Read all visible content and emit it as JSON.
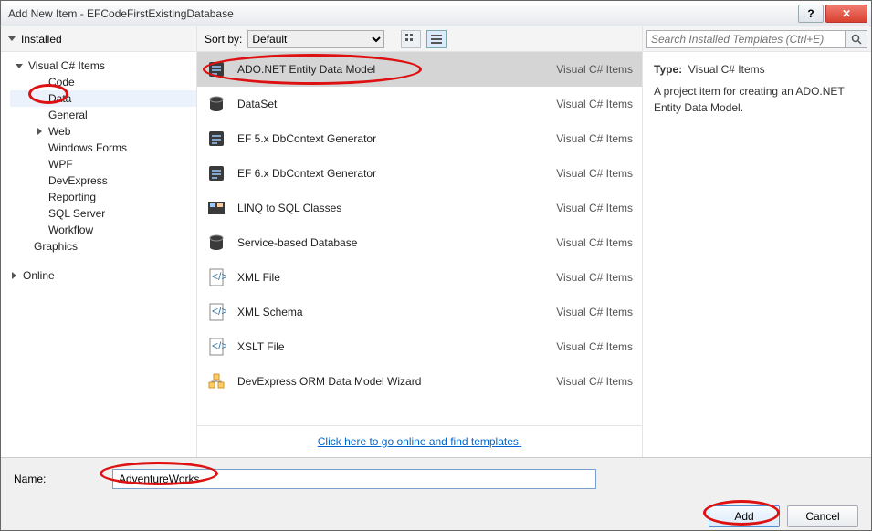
{
  "window": {
    "title": "Add New Item - EFCodeFirstExistingDatabase"
  },
  "left": {
    "header": "Installed",
    "tree": {
      "root": "Visual C# Items",
      "items": [
        "Code",
        "Data",
        "General",
        "Web",
        "Windows Forms",
        "WPF",
        "DevExpress",
        "Reporting",
        "SQL Server",
        "Workflow"
      ],
      "tail": "Graphics",
      "online": "Online"
    }
  },
  "mid": {
    "sortby_label": "Sort by:",
    "sortby_value": "Default",
    "items": [
      {
        "label": "ADO.NET Entity Data Model",
        "cat": "Visual C# Items",
        "selected": true,
        "icon": "entity"
      },
      {
        "label": "DataSet",
        "cat": "Visual C# Items",
        "icon": "db"
      },
      {
        "label": "EF 5.x DbContext Generator",
        "cat": "Visual C# Items",
        "icon": "entity"
      },
      {
        "label": "EF 6.x DbContext Generator",
        "cat": "Visual C# Items",
        "icon": "entity"
      },
      {
        "label": "LINQ to SQL Classes",
        "cat": "Visual C# Items",
        "icon": "linq"
      },
      {
        "label": "Service-based Database",
        "cat": "Visual C# Items",
        "icon": "db"
      },
      {
        "label": "XML File",
        "cat": "Visual C# Items",
        "icon": "xml"
      },
      {
        "label": "XML Schema",
        "cat": "Visual C# Items",
        "icon": "xml"
      },
      {
        "label": "XSLT File",
        "cat": "Visual C# Items",
        "icon": "xml"
      },
      {
        "label": "DevExpress ORM Data Model Wizard",
        "cat": "Visual C# Items",
        "icon": "orm"
      }
    ],
    "footer_link": "Click here to go online and find templates."
  },
  "right": {
    "search_placeholder": "Search Installed Templates (Ctrl+E)",
    "type_label": "Type:",
    "type_value": "Visual C# Items",
    "description": "A project item for creating an ADO.NET Entity Data Model."
  },
  "footer": {
    "name_label": "Name:",
    "name_value": "AdventureWorks",
    "add": "Add",
    "cancel": "Cancel"
  }
}
